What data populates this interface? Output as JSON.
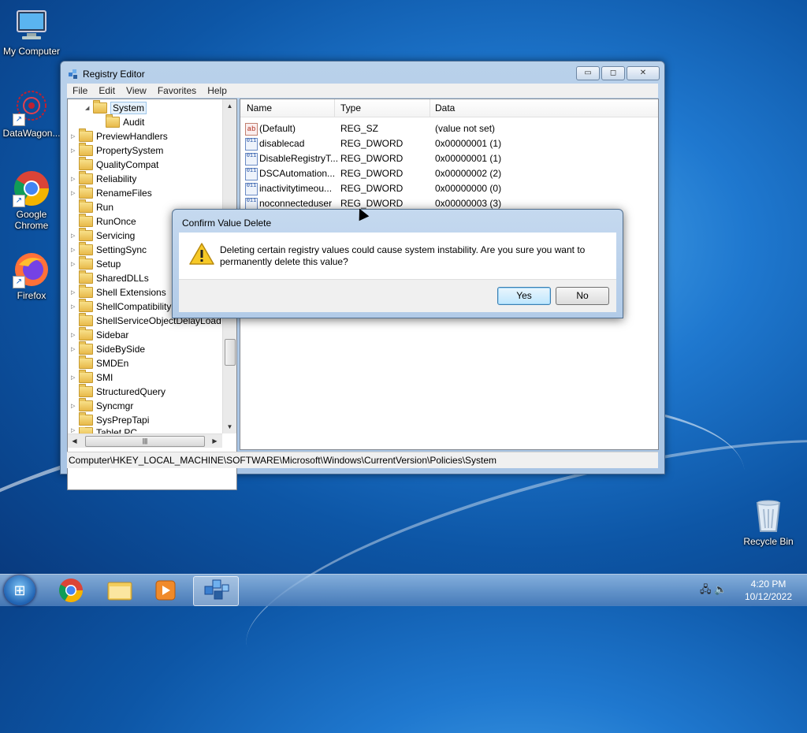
{
  "desktop": {
    "icons": [
      {
        "label": "My Computer"
      },
      {
        "label": "DataWagon..."
      },
      {
        "label": "Google Chrome"
      },
      {
        "label": "Firefox"
      },
      {
        "label": "Recycle Bin"
      }
    ]
  },
  "window": {
    "title": "Registry Editor",
    "caption": {
      "minimize": "▭",
      "maximize": "◻",
      "close": "✕"
    },
    "menu": [
      "File",
      "Edit",
      "View",
      "Favorites",
      "Help"
    ],
    "tree": [
      "System",
      "Audit",
      "PreviewHandlers",
      "PropertySystem",
      "QualityCompat",
      "Reliability",
      "RenameFiles",
      "Run",
      "RunOnce",
      "Servicing",
      "SettingSync",
      "Setup",
      "SharedDLLs",
      "Shell Extensions",
      "ShellCompatibility",
      "ShellServiceObjectDelayLoad",
      "Sidebar",
      "SideBySide",
      "SMDEn",
      "SMI",
      "StructuredQuery",
      "Syncmgr",
      "SysPrepTapi",
      "Tablet PC"
    ],
    "columns": {
      "name": "Name",
      "type": "Type",
      "data": "Data"
    },
    "values": [
      {
        "name": "(Default)",
        "type": "REG_SZ",
        "data": "(value not set)",
        "icon": "ab"
      },
      {
        "name": "disablecad",
        "type": "REG_DWORD",
        "data": "0x00000001 (1)",
        "icon": "011"
      },
      {
        "name": "DisableRegistryT...",
        "type": "REG_DWORD",
        "data": "0x00000001 (1)",
        "icon": "011"
      },
      {
        "name": "DSCAutomation...",
        "type": "REG_DWORD",
        "data": "0x00000002 (2)",
        "icon": "011"
      },
      {
        "name": "inactivitytimeou...",
        "type": "REG_DWORD",
        "data": "0x00000000 (0)",
        "icon": "011"
      },
      {
        "name": "noconnecteduser",
        "type": "REG_DWORD",
        "data": "0x00000003 (3)",
        "icon": "011"
      }
    ],
    "status": "Computer\\HKEY_LOCAL_MACHINE\\SOFTWARE\\Microsoft\\Windows\\CurrentVersion\\Policies\\System"
  },
  "dialog": {
    "title": "Confirm Value Delete",
    "message": "Deleting certain registry values could cause system instability. Are you sure you want to permanently delete this value?",
    "yes": "Yes",
    "no": "No"
  },
  "taskbar": {
    "time": "4:20 PM",
    "date": "10/12/2022"
  }
}
